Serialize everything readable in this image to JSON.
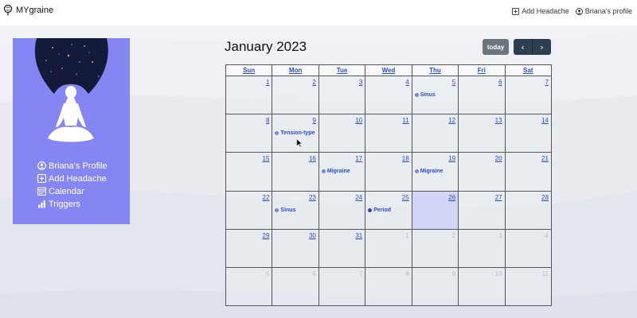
{
  "app": {
    "title": "MYgraine"
  },
  "navbar": {
    "add_headache_label": "Add Headache",
    "profile_label": "Briana's profile"
  },
  "sidebar": {
    "items": [
      {
        "label": "Briana's Profile",
        "icon": "user-circle-icon"
      },
      {
        "label": "Add Headache",
        "icon": "plus-square-icon"
      },
      {
        "label": "Calendar",
        "icon": "calendar-icon"
      },
      {
        "label": "Triggers",
        "icon": "bar-chart-icon"
      }
    ]
  },
  "calendar": {
    "title": "January 2023",
    "today_label": "today",
    "prev_icon": "chevron-left-icon",
    "next_icon": "chevron-right-icon",
    "weekdays": [
      "Sun",
      "Mon",
      "Tue",
      "Wed",
      "Thu",
      "Fri",
      "Sat"
    ],
    "weeks": [
      [
        {
          "day": "1"
        },
        {
          "day": "2"
        },
        {
          "day": "3"
        },
        {
          "day": "4"
        },
        {
          "day": "5",
          "event": "Sinus"
        },
        {
          "day": "6"
        },
        {
          "day": "7"
        }
      ],
      [
        {
          "day": "8"
        },
        {
          "day": "9",
          "event": "Tension-type"
        },
        {
          "day": "10"
        },
        {
          "day": "11"
        },
        {
          "day": "12"
        },
        {
          "day": "13"
        },
        {
          "day": "14"
        }
      ],
      [
        {
          "day": "15"
        },
        {
          "day": "16"
        },
        {
          "day": "17",
          "event": "Migraine"
        },
        {
          "day": "18"
        },
        {
          "day": "19",
          "event": "Migraine"
        },
        {
          "day": "20"
        },
        {
          "day": "21"
        }
      ],
      [
        {
          "day": "22"
        },
        {
          "day": "23",
          "event": "Sinus"
        },
        {
          "day": "24"
        },
        {
          "day": "25",
          "event": "Period",
          "dark": true
        },
        {
          "day": "26",
          "today": true
        },
        {
          "day": "27"
        },
        {
          "day": "28"
        }
      ],
      [
        {
          "day": "29"
        },
        {
          "day": "30"
        },
        {
          "day": "31"
        },
        {
          "day": "1",
          "other": true
        },
        {
          "day": "2",
          "other": true
        },
        {
          "day": "3",
          "other": true
        },
        {
          "day": "4",
          "other": true
        }
      ],
      [
        {
          "day": "5",
          "other": true
        },
        {
          "day": "6",
          "other": true
        },
        {
          "day": "7",
          "other": true
        },
        {
          "day": "8",
          "other": true
        },
        {
          "day": "9",
          "other": true
        },
        {
          "day": "10",
          "other": true
        },
        {
          "day": "11",
          "other": true
        }
      ]
    ]
  },
  "colors": {
    "sidebar_bg": "#8586f3",
    "link_blue": "#2a4bd7",
    "today_highlight": "#d2d5f6",
    "event_dot": "#7f80e0",
    "period_dot": "#3b3f9e",
    "nav_button_dark": "#2c3e50",
    "today_button": "#6c757d"
  }
}
